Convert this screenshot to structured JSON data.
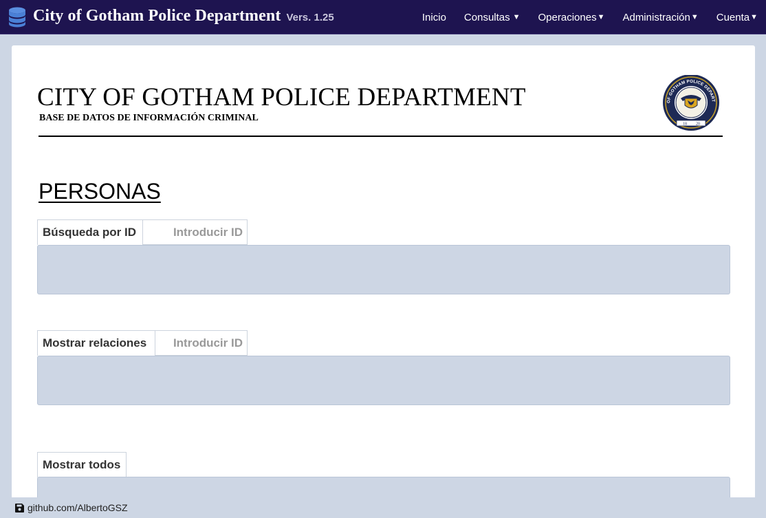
{
  "navbar": {
    "brand_title": "City of Gotham Police Department",
    "version": "Vers. 1.25",
    "menu": [
      {
        "label": "Inicio"
      },
      {
        "label": "Consultas"
      },
      {
        "label": "Operaciones"
      },
      {
        "label": "Administración"
      },
      {
        "label": "Cuenta"
      }
    ],
    "caret": "▼"
  },
  "header": {
    "title": "CITY OF GOTHAM POLICE DEPARTMENT",
    "subtitle": "BASE DE DATOS DE INFORMACIÓN CRIMINAL",
    "badge_text": "CITY OF GOTHAM POLICE DEPARTMENT",
    "badge_year_left": "18",
    "badge_year_right": "20"
  },
  "section": {
    "title": "PERSONAS",
    "search_by_id": {
      "label": "Búsqueda por ID",
      "placeholder": "Introducir ID"
    },
    "show_relations": {
      "label": "Mostrar relaciones",
      "placeholder": "Introducir ID"
    },
    "show_all": {
      "label": "Mostrar todos"
    }
  },
  "footer": {
    "link": "github.com/AlbertoGSZ"
  },
  "colors": {
    "navbar_bg": "#1e1450",
    "page_bg": "#cdd6e4",
    "result_box_bg": "#cdd6e4"
  },
  "icons": {
    "brand": "database-icon",
    "footer": "floppy-disk-icon"
  }
}
